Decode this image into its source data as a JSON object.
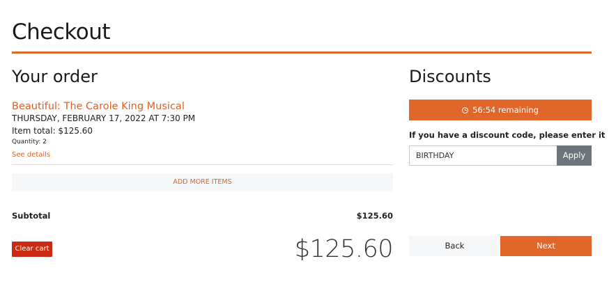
{
  "page": {
    "title": "Checkout"
  },
  "order": {
    "heading": "Your order",
    "item": {
      "title": "Beautiful: The Carole King Musical",
      "date": "THURSDAY, FEBRUARY 17, 2022 AT 7:30 PM",
      "item_total": "Item total: $125.60",
      "quantity": "Quantity: 2",
      "see_details": "See details"
    },
    "add_more_label": "ADD MORE ITEMS",
    "subtotal_label": "Subtotal",
    "subtotal_value": "$125.60",
    "clear_cart_label": "Clear cart",
    "total_display": "$125.60"
  },
  "discounts": {
    "heading": "Discounts",
    "timer_text": "56:54 remaining",
    "prompt": "If you have a discount code, please enter it",
    "code_value": "BIRTHDAY",
    "apply_label": "Apply"
  },
  "nav": {
    "back_label": "Back",
    "next_label": "Next"
  },
  "colors": {
    "accent": "#e0662a",
    "danger": "#c92a11",
    "secondary": "#6c757d",
    "light": "#f6f7f8"
  },
  "icons": {
    "timer": "clock-icon"
  }
}
